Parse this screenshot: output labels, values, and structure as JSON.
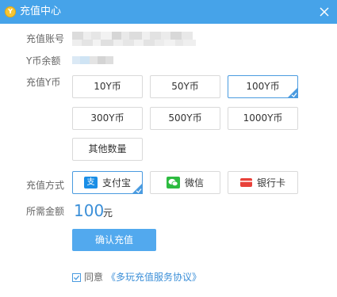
{
  "window": {
    "title": "充值中心",
    "logo_glyph": "Y",
    "close_icon": "close-icon"
  },
  "form": {
    "account_label": "充值账号",
    "balance_label": "Y币余额",
    "amount_label": "充值Y币",
    "method_label": "充值方式",
    "required_label": "所需金额"
  },
  "amounts": [
    {
      "label": "10Y币",
      "selected": false
    },
    {
      "label": "50Y币",
      "selected": false
    },
    {
      "label": "100Y币",
      "selected": true
    },
    {
      "label": "300Y币",
      "selected": false
    },
    {
      "label": "500Y币",
      "selected": false
    },
    {
      "label": "1000Y币",
      "selected": false
    },
    {
      "label": "其他数量",
      "selected": false
    }
  ],
  "payment_methods": [
    {
      "label": "支付宝",
      "icon": "alipay-icon",
      "icon_glyph": "支",
      "color": "#1a8ee6",
      "selected": true
    },
    {
      "label": "微信",
      "icon": "wechat-icon",
      "icon_glyph": "✉",
      "color": "#2dbb40",
      "selected": false
    },
    {
      "label": "银行卡",
      "icon": "bank-card-icon",
      "icon_glyph": "",
      "color": "#e8413a",
      "selected": false
    }
  ],
  "total": {
    "value": "100",
    "unit": "元"
  },
  "confirm_button": "确认充值",
  "agreement": {
    "checked": true,
    "text": "同意",
    "link": "《多玩充值服务协议》"
  },
  "colors": {
    "title_bar": "#46a3e9",
    "accent": "#4a9be0",
    "button": "#52a9ee"
  }
}
